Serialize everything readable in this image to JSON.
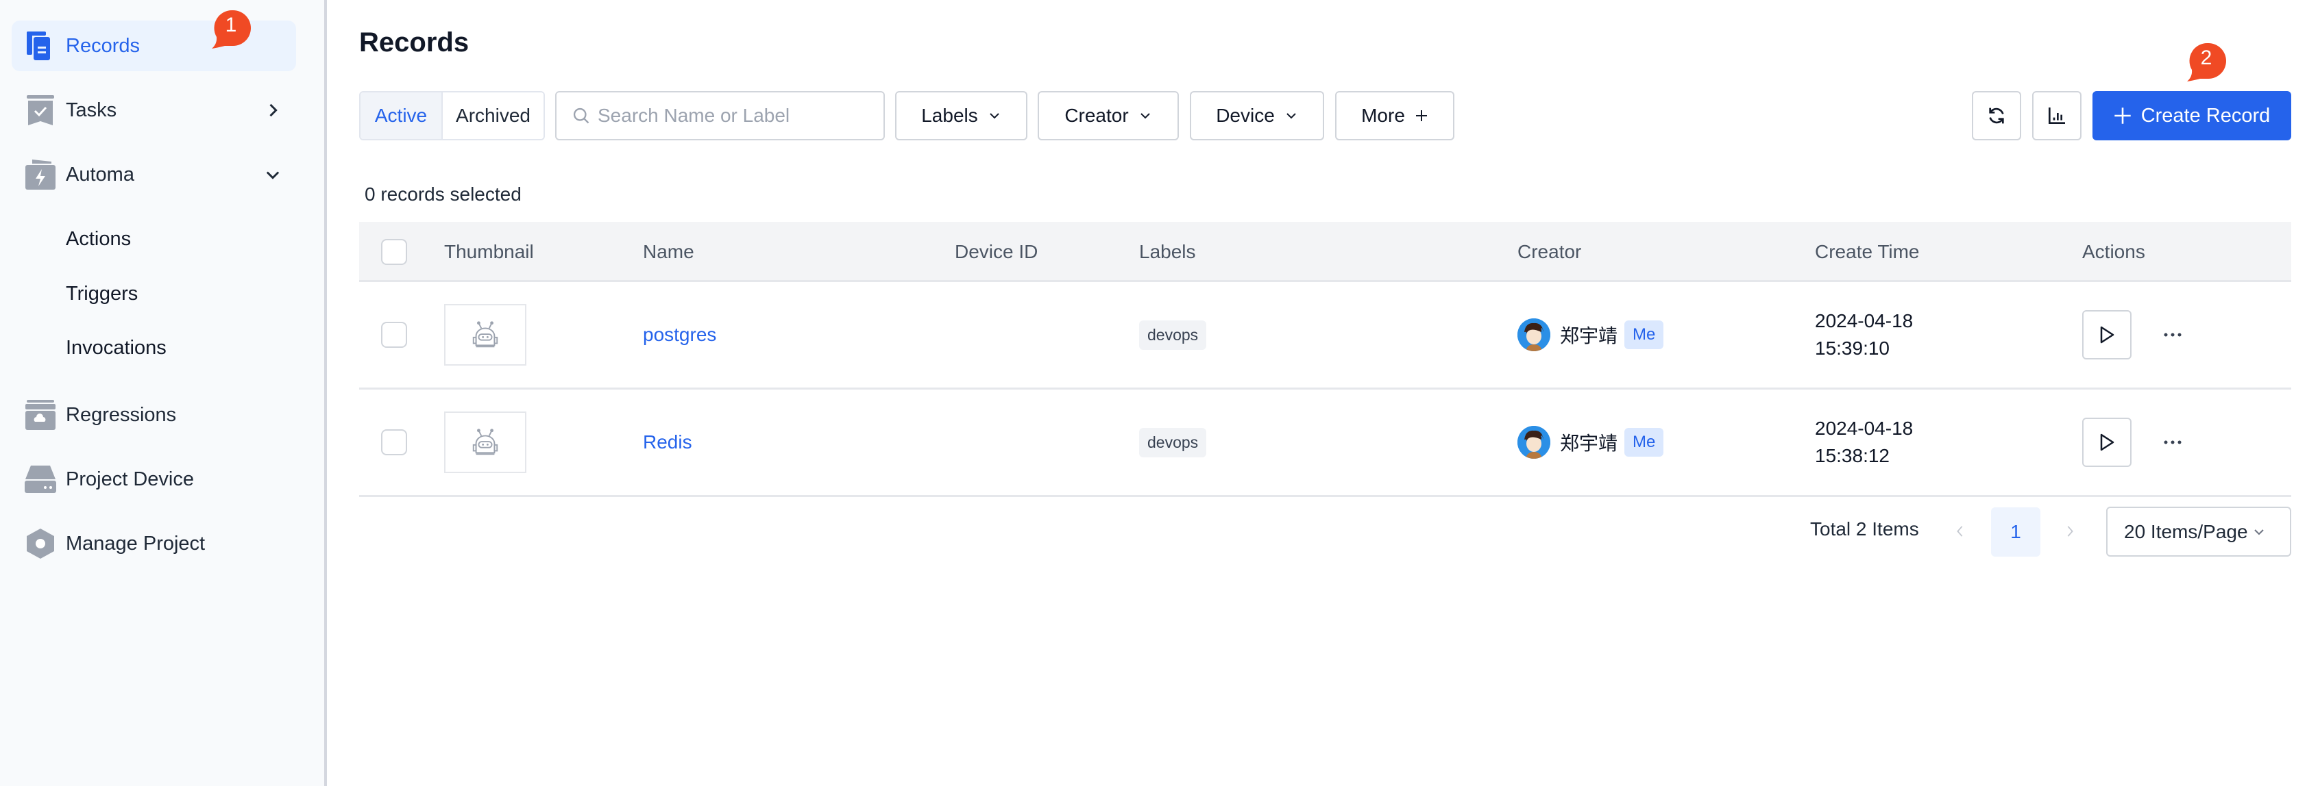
{
  "sidebar": {
    "items": [
      {
        "label": "Records",
        "icon": "records-icon",
        "active": true
      },
      {
        "label": "Tasks",
        "icon": "tasks-icon",
        "chevron": "chevron-right"
      },
      {
        "label": "Automa",
        "icon": "automa-icon",
        "chevron": "chevron-down"
      },
      {
        "label": "Regressions",
        "icon": "regressions-icon"
      },
      {
        "label": "Project Device",
        "icon": "project-device-icon"
      },
      {
        "label": "Manage Project",
        "icon": "manage-project-icon"
      }
    ],
    "automa_children": [
      "Actions",
      "Triggers",
      "Invocations"
    ]
  },
  "markers": {
    "m1": "1",
    "m2": "2"
  },
  "colors": {
    "accent": "#2563eb",
    "marker": "#f04a24"
  },
  "header": {
    "title": "Records"
  },
  "toolbar": {
    "status_tabs": {
      "active": "Active",
      "archived": "Archived",
      "selected": "Active"
    },
    "search": {
      "placeholder": "Search Name or Label",
      "value": ""
    },
    "filters": {
      "labels": "Labels",
      "creator": "Creator",
      "device": "Device",
      "more": "More"
    },
    "create_label": "Create Record"
  },
  "selection": {
    "text": "0 records selected"
  },
  "table": {
    "columns": [
      "Thumbnail",
      "Name",
      "Device ID",
      "Labels",
      "Creator",
      "Create Time",
      "Actions"
    ],
    "rows": [
      {
        "name": "postgres",
        "device_id": "",
        "label": "devops",
        "creator": "郑宇靖",
        "me": "Me",
        "date": "2024-04-18",
        "time": "15:39:10"
      },
      {
        "name": "Redis",
        "device_id": "",
        "label": "devops",
        "creator": "郑宇靖",
        "me": "Me",
        "date": "2024-04-18",
        "time": "15:38:12"
      }
    ]
  },
  "pagination": {
    "total": "Total 2 Items",
    "current_page": "1",
    "page_size": "20 Items/Page"
  }
}
